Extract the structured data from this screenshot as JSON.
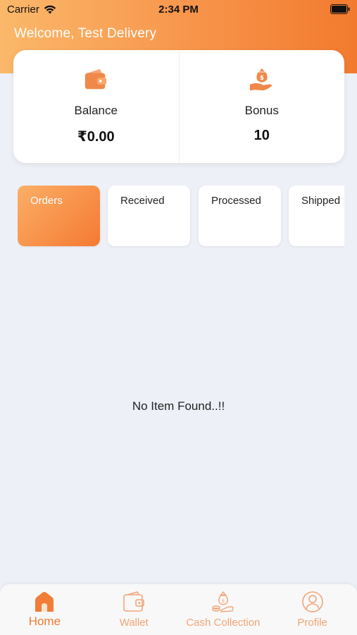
{
  "status_bar": {
    "carrier": "Carrier",
    "time": "2:34 PM"
  },
  "header": {
    "welcome": "Welcome, Test Delivery"
  },
  "summary": {
    "balance": {
      "icon": "wallet-icon",
      "label": "Balance",
      "value": "₹0.00"
    },
    "bonus": {
      "icon": "money-hand-icon",
      "label": "Bonus",
      "value": "10"
    }
  },
  "order_tabs": [
    {
      "label": "Orders",
      "active": true
    },
    {
      "label": "Received",
      "active": false
    },
    {
      "label": "Processed",
      "active": false
    },
    {
      "label": "Shipped",
      "active": false
    }
  ],
  "empty_state": {
    "text": "No Item Found..!!"
  },
  "bottom_nav": [
    {
      "label": "Home",
      "icon": "home-icon",
      "active": true
    },
    {
      "label": "Wallet",
      "icon": "wallet-icon",
      "active": false
    },
    {
      "label": "Cash Collection",
      "icon": "cash-bag-icon",
      "active": false
    },
    {
      "label": "Profile",
      "icon": "profile-icon",
      "active": false
    }
  ],
  "colors": {
    "accent": "#f47a32",
    "accent_light": "#fbb86a",
    "background": "#eef0f7"
  }
}
